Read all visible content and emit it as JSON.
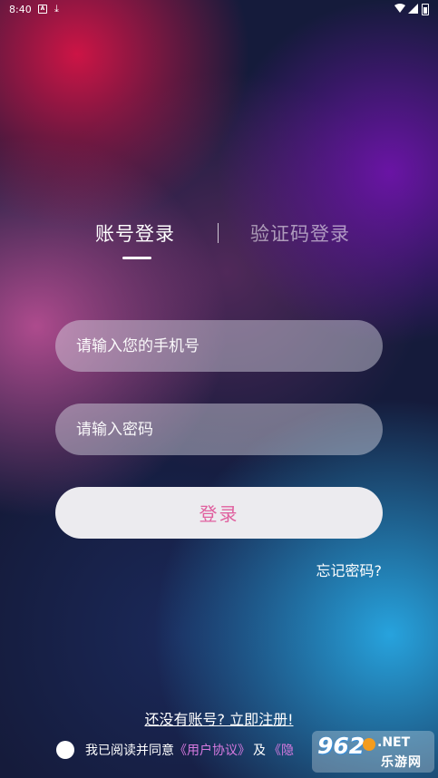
{
  "status_bar": {
    "time": "8:40",
    "a_icon_letter": "A"
  },
  "tabs": {
    "account": "账号登录",
    "separator": "|",
    "code": "验证码登录",
    "active": "account"
  },
  "form": {
    "phone_placeholder": "请输入您的手机号",
    "password_placeholder": "请输入密码",
    "login_label": "登录",
    "forgot_label": "忘记密码?"
  },
  "register_label": "还没有账号? 立即注册!",
  "agreement": {
    "prefix": "我已阅读并同意",
    "user_agreement": "《用户协议》",
    "and": "及",
    "privacy_partial": "《隐"
  },
  "watermark": {
    "number": "962",
    "net": ".NET",
    "cn": "乐游网"
  },
  "colors": {
    "accent": "#e0609f",
    "link": "#d77ae0",
    "field_bg": "rgba(220,220,230,0.45)"
  }
}
